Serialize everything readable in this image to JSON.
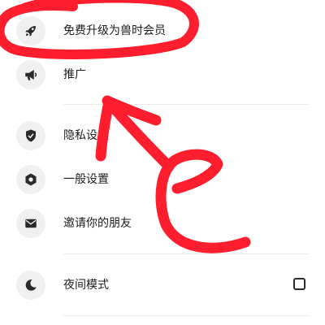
{
  "menu": {
    "items": [
      {
        "label": "免费升级为兽时会员",
        "icon": "rocket-icon"
      },
      {
        "label": "推广",
        "icon": "megaphone-icon"
      },
      {
        "label": "隐私设置",
        "icon": "shield-check-icon"
      },
      {
        "label": "一般设置",
        "icon": "gear-icon"
      },
      {
        "label": "邀请你的朋友",
        "icon": "envelope-icon"
      },
      {
        "label": "夜间模式",
        "icon": "moon-icon",
        "checked": false
      }
    ]
  },
  "annotation": {
    "color": "#ff1e2d",
    "marks": [
      "circle-around-upgrade-item",
      "arrow-pointing-up",
      "letter-e"
    ]
  }
}
